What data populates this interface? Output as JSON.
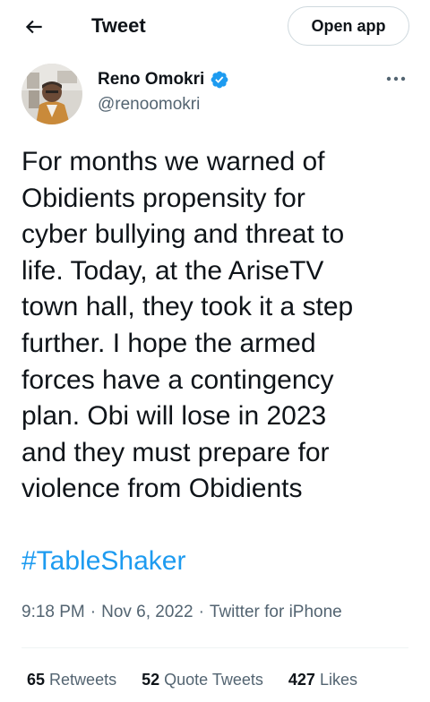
{
  "header": {
    "title": "Tweet",
    "open_app_label": "Open app"
  },
  "author": {
    "name": "Reno Omokri",
    "handle": "@renoomokri",
    "verified": true
  },
  "tweet": {
    "text": "For months we warned of\nObidients propensity for\ncyber bullying and threat to\nlife. Today, at the AriseTV\ntown hall, they took it a step\nfurther. I hope the armed\nforces have a contingency\nplan. Obi will lose in 2023\nand they must prepare for\nviolence from Obidients",
    "hashtag": "#TableShaker",
    "time": "9:18 PM",
    "date": "Nov 6, 2022",
    "source": "Twitter for iPhone"
  },
  "stats": {
    "retweets_count": "65",
    "retweets_label": "Retweets",
    "quote_count": "52",
    "quote_label": "Quote Tweets",
    "likes_count": "427",
    "likes_label": "Likes"
  },
  "icons": {
    "back": "arrow-left-icon",
    "verified": "verified-badge-icon",
    "more": "more-horizontal-icon"
  },
  "colors": {
    "link": "#1d9bf0",
    "secondary_text": "#536471",
    "primary_text": "#0f1419"
  }
}
